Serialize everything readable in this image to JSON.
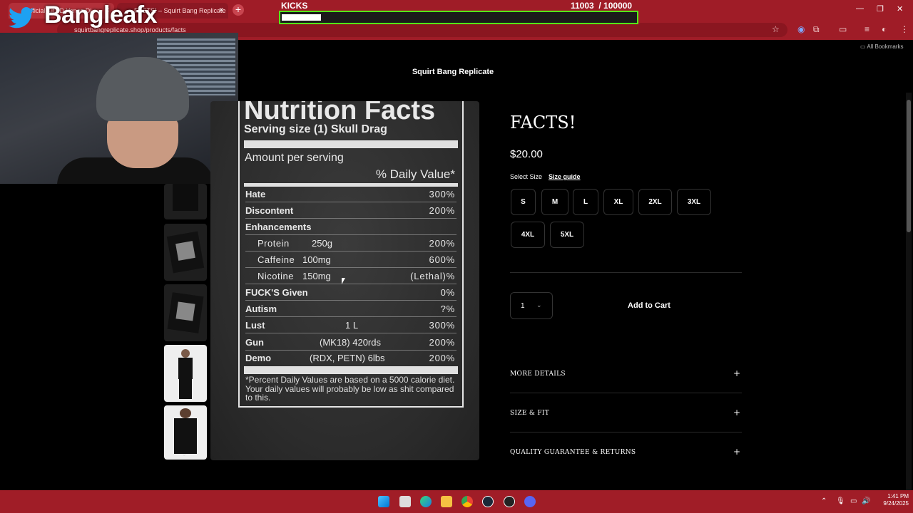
{
  "browser": {
    "tabs": [
      {
        "label": "Official Kit JD Vance Di",
        "active": false
      },
      {
        "label": "FACTS! – Squirt Bang Replicate",
        "active": true
      }
    ],
    "url": "squirtbangreplicate.shop/products/facts",
    "bookmarks_label": "All Bookmarks"
  },
  "overlay": {
    "brand": "Bangleafx",
    "kicks_label": "KICKS",
    "kicks_current": "11003",
    "kicks_goal": "/ 100000",
    "kicks_progress": 0.11
  },
  "store": {
    "name": "Squirt Bang Replicate"
  },
  "nutrition": {
    "title": "Nutrition Facts",
    "serving": "Serving size (1) Skull Drag",
    "amount_per_serving": "Amount per serving",
    "daily_value": "% Daily Value*",
    "rows": [
      {
        "name": "Hate",
        "mid": "",
        "pct": "300%",
        "sub": false
      },
      {
        "name": "Discontent",
        "mid": "",
        "pct": "200%",
        "sub": false
      },
      {
        "name": "Enhancements",
        "mid": "",
        "pct": "",
        "sub": false
      },
      {
        "name": "Protein",
        "mid": "250g",
        "pct": "200%",
        "sub": true
      },
      {
        "name": "Caffeine",
        "mid": "100mg",
        "pct": "600%",
        "sub": true
      },
      {
        "name": "Nicotine",
        "mid": "150mg",
        "pct": "(Lethal)%",
        "sub": true
      },
      {
        "name": "FUCK'S Given",
        "mid": "",
        "pct": "0%",
        "sub": false
      },
      {
        "name": "Autism",
        "mid": "",
        "pct": "?%",
        "sub": false
      },
      {
        "name": "Lust",
        "mid": "1 L",
        "pct": "300%",
        "sub": false
      },
      {
        "name": "Gun",
        "mid": "(MK18) 420rds",
        "pct": "200%",
        "sub": false
      },
      {
        "name": "Demo",
        "mid": "(RDX, PETN) 6lbs",
        "pct": "200%",
        "sub": false
      }
    ],
    "footnote": "*Percent Daily Values are based on a 5000 calorie diet. Your daily values will probably be low as shit compared to this."
  },
  "product": {
    "title": "FACTS!",
    "price": "$20.00",
    "select_size_label": "Select Size",
    "size_guide_label": "Size guide",
    "sizes": [
      "S",
      "M",
      "L",
      "XL",
      "2XL",
      "3XL",
      "4XL",
      "5XL"
    ],
    "quantity": "1",
    "add_to_cart": "Add to Cart",
    "accordions": [
      "MORE DETAILS",
      "SIZE & FIT",
      "QUALITY GUARANTEE & RETURNS"
    ]
  },
  "taskbar": {
    "time": "1:41 PM",
    "date": "9/24/2025"
  },
  "colors": {
    "chrome_red": "#9f1c27",
    "kick_green": "#53fc18",
    "page_bg": "#000000"
  },
  "icons": {
    "twitter": "twitter-bird-icon",
    "star": "bookmark-star-icon",
    "chevron": "chevron-down-icon",
    "plus": "plus-icon"
  }
}
